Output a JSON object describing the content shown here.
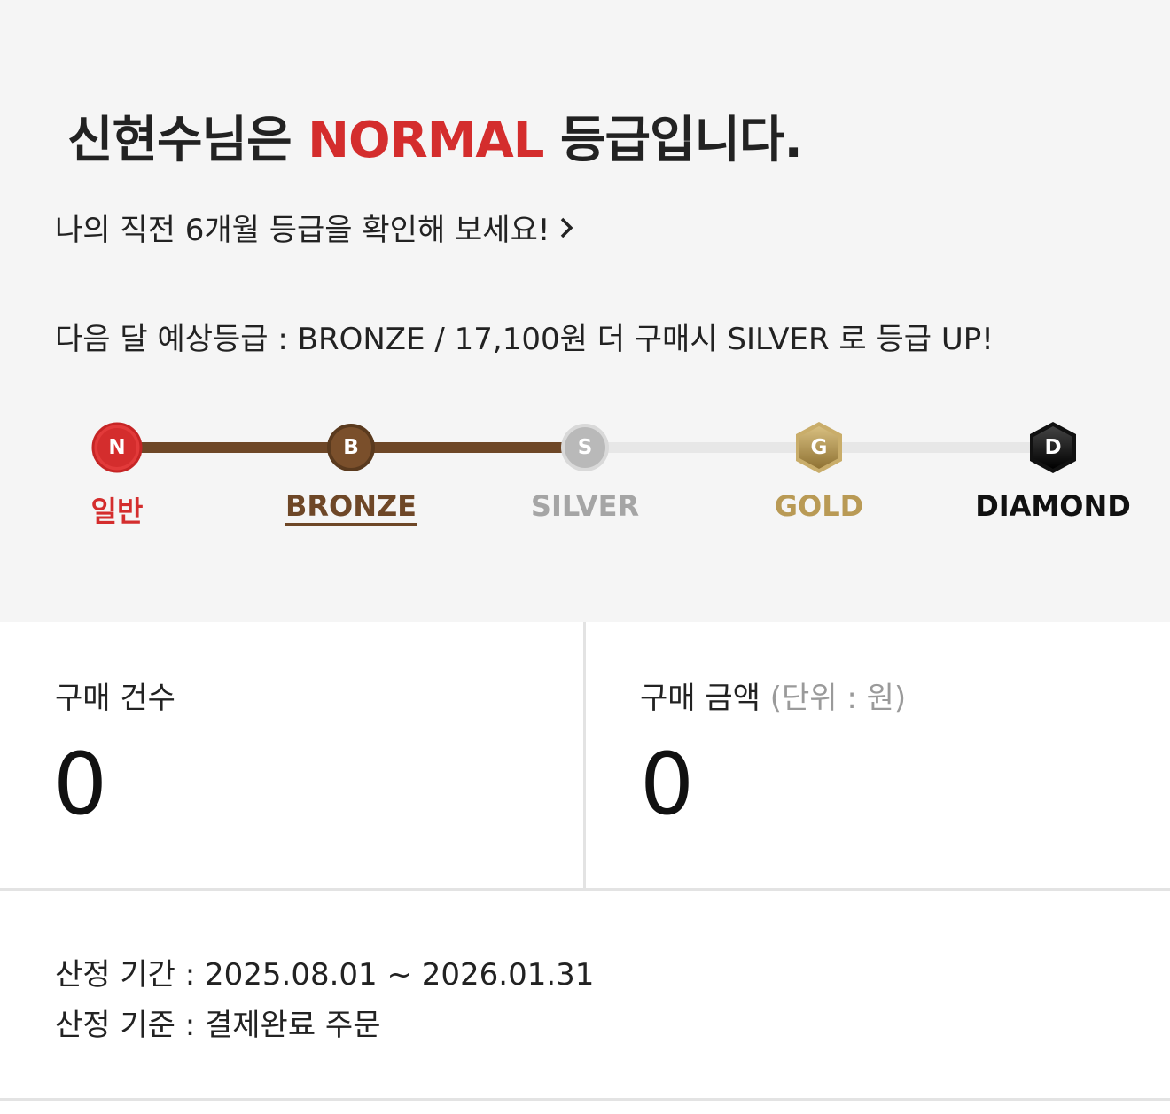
{
  "headline": {
    "name_prefix": "신현수님은 ",
    "grade": "NORMAL",
    "suffix": " 등급입니다."
  },
  "history_link": {
    "label": "나의 직전 6개월 등급을 확인해 보세요!",
    "icon": "chevron-right-icon"
  },
  "forecast": {
    "text": "다음 달 예상등급 : BRONZE / 17,100원 더 구매시 SILVER 로 등급 UP!"
  },
  "grade_track": {
    "progress_fraction": 0.5,
    "levels": [
      {
        "letter": "N",
        "label": "일반",
        "color": "#d42d2d",
        "shape": "circle"
      },
      {
        "letter": "B",
        "label": "BRONZE",
        "color": "#6e4727",
        "shape": "circle"
      },
      {
        "letter": "S",
        "label": "SILVER",
        "color": "#c4c4c4",
        "shape": "circle"
      },
      {
        "letter": "G",
        "label": "GOLD",
        "color": "#b99a55",
        "shape": "hexagon"
      },
      {
        "letter": "D",
        "label": "DIAMOND",
        "color": "#111111",
        "shape": "hexagon"
      }
    ]
  },
  "stats": {
    "count": {
      "title": "구매 건수",
      "value": "0"
    },
    "amount": {
      "title": "구매 금액",
      "unit": "(단위 : 원)",
      "value": "0"
    }
  },
  "info": {
    "period": "산정 기간 :  2025.08.01 ~ 2026.01.31",
    "criteria": "산정 기준 : 결제완료 주문"
  }
}
